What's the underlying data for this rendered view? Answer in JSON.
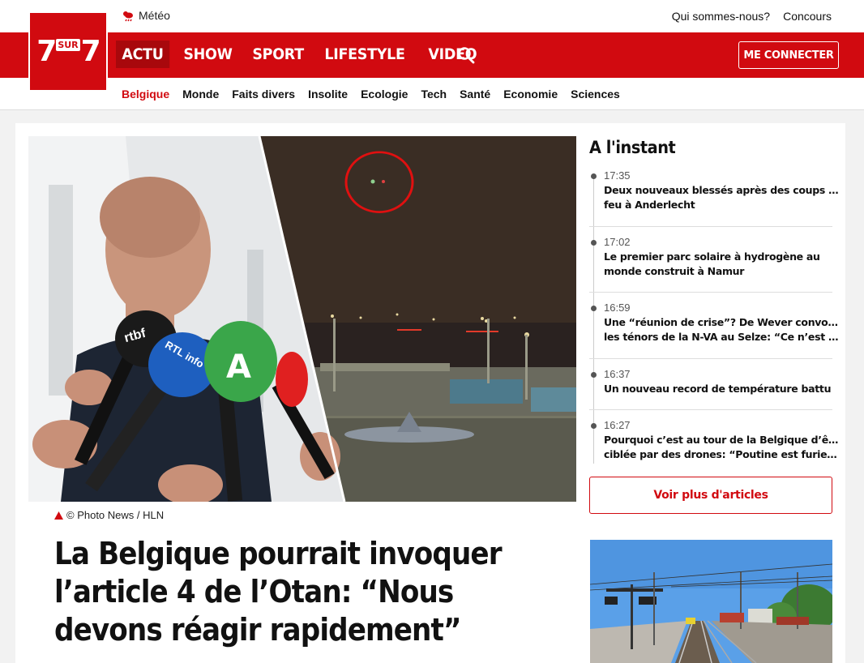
{
  "topbar": {
    "meteo": "Météo",
    "links": [
      "Qui sommes-nous?",
      "Concours"
    ]
  },
  "logo": {
    "left": "7",
    "sur": "SUR",
    "right": "7"
  },
  "mainnav": {
    "items": [
      "ACTU",
      "SHOW",
      "SPORT",
      "LIFESTYLE",
      "VIDEO"
    ],
    "login": "ME CONNECTER"
  },
  "subnav": {
    "items": [
      "Belgique",
      "Monde",
      "Faits divers",
      "Insolite",
      "Ecologie",
      "Tech",
      "Santé",
      "Economie",
      "Sciences"
    ]
  },
  "article": {
    "caption": "© Photo News / HLN",
    "headline": "La Belgique pourrait invoquer l’article 4 de l’Otan: “Nous devons réagir rapidement”",
    "mic_labels": [
      "rtbf",
      "RTL info",
      "A"
    ]
  },
  "sidebar": {
    "title": "A l'instant",
    "items": [
      {
        "time": "17:35",
        "lines": [
          "Deux nouveaux blessés après des coups de",
          "feu à Anderlecht"
        ]
      },
      {
        "time": "17:02",
        "lines": [
          "Le premier parc solaire à hydrogène au",
          "monde construit à Namur"
        ]
      },
      {
        "time": "16:59",
        "lines": [
          "Une “réunion de crise”? De Wever convoque",
          "les ténors de la N-VA au Selze: “Ce n’est pas…"
        ]
      },
      {
        "time": "16:37",
        "lines": [
          "Un nouveau record de température battu"
        ]
      },
      {
        "time": "16:27",
        "lines": [
          "Pourquoi c’est au tour de la Belgique d’être",
          "ciblée par des drones: “Poutine est furieux à…"
        ]
      }
    ],
    "more": "Voir plus d'articles"
  },
  "colors": {
    "brand_red": "#d10a10",
    "active_dark_red": "#a8080c"
  },
  "icons": [
    "weather-icon",
    "search-icon",
    "warning-triangle-icon"
  ]
}
